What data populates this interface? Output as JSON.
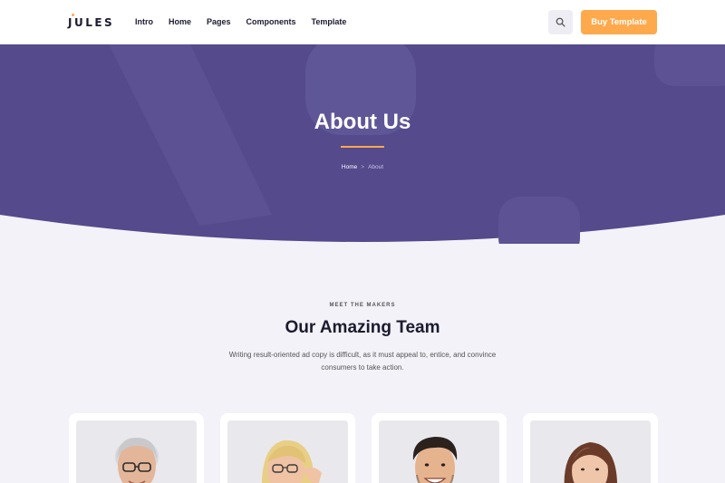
{
  "brand": {
    "name": "JULES",
    "accent": "#ffa94d",
    "hero_color": "#544a8c"
  },
  "nav": {
    "items": [
      "Intro",
      "Home",
      "Pages",
      "Components",
      "Template"
    ]
  },
  "header": {
    "search_icon": "search-icon",
    "buy_label": "Buy Template"
  },
  "hero": {
    "title": "About Us",
    "breadcrumb": {
      "home": "Home",
      "separator": ">",
      "current": "About"
    }
  },
  "team": {
    "eyebrow": "MEET THE MAKERS",
    "title": "Our Amazing Team",
    "description": "Writing result-oriented ad copy is difficult, as it must appeal to, entice, and convince consumers to take action.",
    "members": [
      {
        "photo": "older man with glasses"
      },
      {
        "photo": "blonde woman with glasses"
      },
      {
        "photo": "smiling young man"
      },
      {
        "photo": "woman with brown hair"
      }
    ]
  }
}
